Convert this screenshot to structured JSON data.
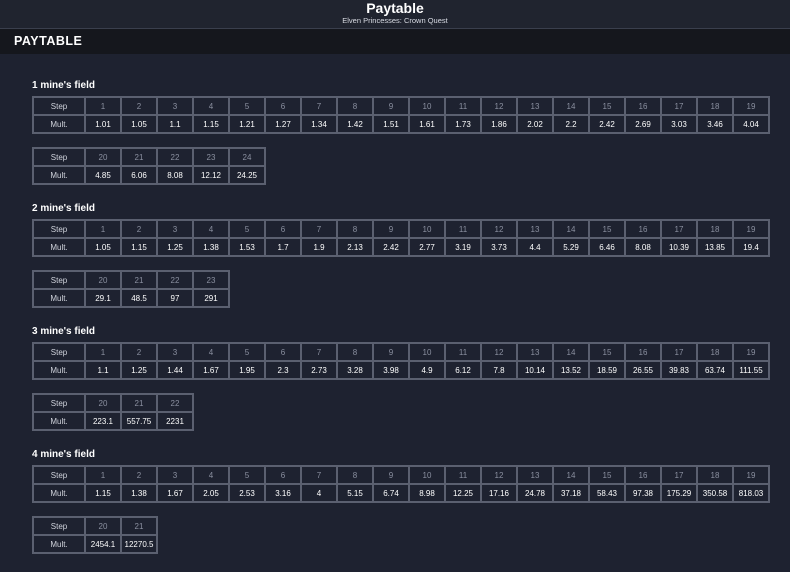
{
  "topbar": {
    "title": "Paytable",
    "subtitle": "Elven Princesses: Crown Quest"
  },
  "header": {
    "label": "PAYTABLE"
  },
  "labels": {
    "step": "Step",
    "mult": "Mult."
  },
  "fields": [
    {
      "title": "1 mine's field",
      "tables": [
        {
          "steps": [
            "1",
            "2",
            "3",
            "4",
            "5",
            "6",
            "7",
            "8",
            "9",
            "10",
            "11",
            "12",
            "13",
            "14",
            "15",
            "16",
            "17",
            "18",
            "19"
          ],
          "mults": [
            "1.01",
            "1.05",
            "1.1",
            "1.15",
            "1.21",
            "1.27",
            "1.34",
            "1.42",
            "1.51",
            "1.61",
            "1.73",
            "1.86",
            "2.02",
            "2.2",
            "2.42",
            "2.69",
            "3.03",
            "3.46",
            "4.04"
          ]
        },
        {
          "steps": [
            "20",
            "21",
            "22",
            "23",
            "24"
          ],
          "mults": [
            "4.85",
            "6.06",
            "8.08",
            "12.12",
            "24.25"
          ]
        }
      ]
    },
    {
      "title": "2 mine's field",
      "tables": [
        {
          "steps": [
            "1",
            "2",
            "3",
            "4",
            "5",
            "6",
            "7",
            "8",
            "9",
            "10",
            "11",
            "12",
            "13",
            "14",
            "15",
            "16",
            "17",
            "18",
            "19"
          ],
          "mults": [
            "1.05",
            "1.15",
            "1.25",
            "1.38",
            "1.53",
            "1.7",
            "1.9",
            "2.13",
            "2.42",
            "2.77",
            "3.19",
            "3.73",
            "4.4",
            "5.29",
            "6.46",
            "8.08",
            "10.39",
            "13.85",
            "19.4"
          ]
        },
        {
          "steps": [
            "20",
            "21",
            "22",
            "23"
          ],
          "mults": [
            "29.1",
            "48.5",
            "97",
            "291"
          ]
        }
      ]
    },
    {
      "title": "3 mine's field",
      "tables": [
        {
          "steps": [
            "1",
            "2",
            "3",
            "4",
            "5",
            "6",
            "7",
            "8",
            "9",
            "10",
            "11",
            "12",
            "13",
            "14",
            "15",
            "16",
            "17",
            "18",
            "19"
          ],
          "mults": [
            "1.1",
            "1.25",
            "1.44",
            "1.67",
            "1.95",
            "2.3",
            "2.73",
            "3.28",
            "3.98",
            "4.9",
            "6.12",
            "7.8",
            "10.14",
            "13.52",
            "18.59",
            "26.55",
            "39.83",
            "63.74",
            "111.55"
          ]
        },
        {
          "steps": [
            "20",
            "21",
            "22"
          ],
          "mults": [
            "223.1",
            "557.75",
            "2231"
          ]
        }
      ]
    },
    {
      "title": "4 mine's field",
      "tables": [
        {
          "steps": [
            "1",
            "2",
            "3",
            "4",
            "5",
            "6",
            "7",
            "8",
            "9",
            "10",
            "11",
            "12",
            "13",
            "14",
            "15",
            "16",
            "17",
            "18",
            "19"
          ],
          "mults": [
            "1.15",
            "1.38",
            "1.67",
            "2.05",
            "2.53",
            "3.16",
            "4",
            "5.15",
            "6.74",
            "8.98",
            "12.25",
            "17.16",
            "24.78",
            "37.18",
            "58.43",
            "97.38",
            "175.29",
            "350.58",
            "818.03"
          ]
        },
        {
          "steps": [
            "20",
            "21"
          ],
          "mults": [
            "2454.1",
            "12270.5"
          ]
        }
      ]
    }
  ]
}
